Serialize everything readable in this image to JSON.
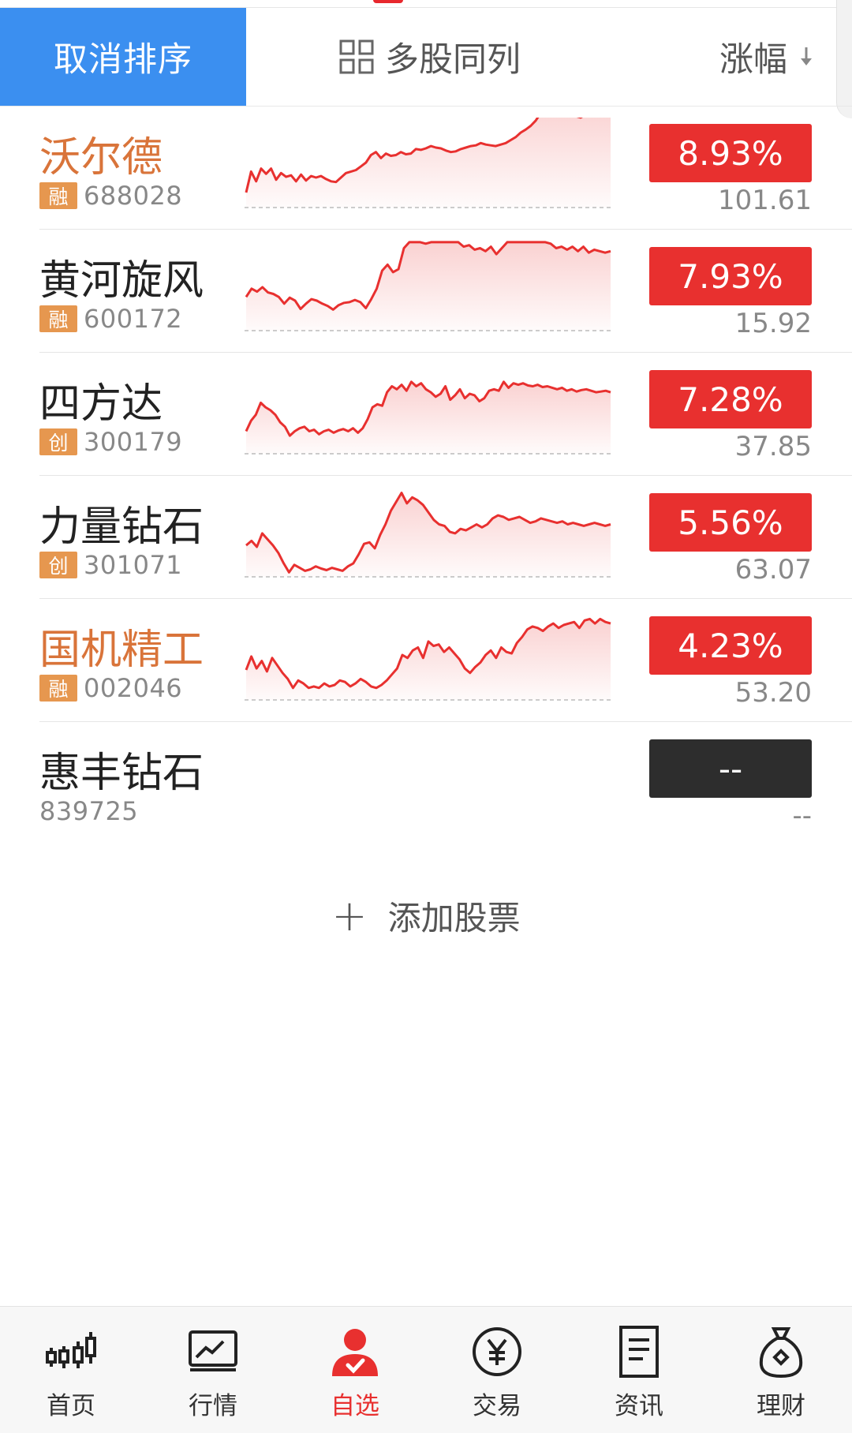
{
  "header": {
    "cancel_sort_label": "取消排序",
    "multi_column_label": "多股同列",
    "sort_label": "涨幅"
  },
  "stocks": [
    {
      "name": "沃尔德",
      "name_color": "orange",
      "badge": "融",
      "code": "688028",
      "change": "8.93%",
      "price": "101.61",
      "trend": [
        20,
        48,
        35,
        52,
        45,
        52,
        37,
        46,
        41,
        43,
        35,
        44,
        36,
        42,
        40,
        42,
        38,
        35,
        34,
        40,
        46,
        48,
        50,
        55,
        60,
        70,
        74,
        66,
        72,
        69,
        70,
        74,
        71,
        72,
        78,
        77,
        79,
        82,
        80,
        79,
        76,
        74,
        75,
        78,
        80,
        82,
        83,
        86,
        84,
        83,
        82,
        84,
        86,
        90,
        94,
        100,
        104,
        109,
        116,
        126,
        140,
        130,
        126,
        124,
        126,
        128,
        122,
        120,
        124,
        126,
        124,
        127,
        124,
        122
      ]
    },
    {
      "name": "黄河旋风",
      "name_color": "normal",
      "badge": "融",
      "code": "600172",
      "change": "7.93%",
      "price": "15.92",
      "trend": [
        45,
        56,
        52,
        58,
        51,
        49,
        45,
        36,
        44,
        40,
        29,
        36,
        42,
        40,
        36,
        33,
        28,
        34,
        37,
        38,
        41,
        38,
        30,
        42,
        56,
        80,
        88,
        78,
        82,
        110,
        118,
        118,
        118,
        116,
        118,
        118,
        118,
        118,
        118,
        118,
        112,
        114,
        108,
        110,
        106,
        112,
        102,
        110,
        118,
        118,
        118,
        118,
        118,
        118,
        118,
        118,
        116,
        110,
        112,
        108,
        112,
        106,
        112,
        104,
        108,
        106,
        104,
        106
      ]
    },
    {
      "name": "四方达",
      "name_color": "normal",
      "badge": "创",
      "code": "300179",
      "change": "7.28%",
      "price": "37.85",
      "trend": [
        30,
        44,
        52,
        68,
        62,
        58,
        52,
        42,
        36,
        24,
        30,
        34,
        36,
        30,
        32,
        26,
        30,
        32,
        28,
        31,
        33,
        30,
        34,
        28,
        34,
        46,
        62,
        66,
        64,
        82,
        90,
        86,
        92,
        84,
        96,
        90,
        94,
        86,
        82,
        76,
        80,
        90,
        72,
        78,
        86,
        74,
        80,
        78,
        70,
        74,
        84,
        86,
        84,
        96,
        88,
        94,
        92,
        94,
        91,
        90,
        92,
        89,
        90,
        88,
        86,
        88,
        84,
        86,
        83,
        85,
        86,
        84,
        82,
        83,
        84,
        82
      ]
    },
    {
      "name": "力量钻石",
      "name_color": "normal",
      "badge": "创",
      "code": "301071",
      "change": "5.56%",
      "price": "63.07",
      "trend": [
        42,
        48,
        40,
        58,
        50,
        42,
        32,
        18,
        6,
        16,
        12,
        8,
        10,
        14,
        11,
        9,
        12,
        10,
        8,
        14,
        18,
        30,
        44,
        46,
        38,
        56,
        70,
        88,
        100,
        112,
        98,
        106,
        102,
        96,
        86,
        76,
        70,
        68,
        60,
        58,
        64,
        62,
        66,
        70,
        66,
        70,
        78,
        82,
        80,
        76,
        78,
        80,
        76,
        72,
        74,
        78,
        76,
        74,
        72,
        74,
        70,
        72,
        70,
        68,
        70,
        72,
        70,
        68,
        70
      ]
    },
    {
      "name": "国机精工",
      "name_color": "orange",
      "badge": "融",
      "code": "002046",
      "change": "4.23%",
      "price": "53.20",
      "trend": [
        40,
        58,
        42,
        52,
        38,
        56,
        46,
        36,
        28,
        16,
        26,
        22,
        16,
        18,
        16,
        22,
        18,
        20,
        26,
        24,
        18,
        22,
        28,
        24,
        18,
        16,
        20,
        26,
        34,
        42,
        60,
        56,
        66,
        70,
        56,
        78,
        72,
        74,
        64,
        70,
        62,
        54,
        42,
        36,
        44,
        50,
        60,
        66,
        56,
        70,
        64,
        62,
        76,
        84,
        94,
        98,
        96,
        92,
        98,
        102,
        96,
        100,
        102,
        104,
        96,
        106,
        108,
        102,
        108,
        104,
        102
      ]
    },
    {
      "name": "惠丰钻石",
      "name_color": "normal",
      "badge": "",
      "code": "839725",
      "change": "--",
      "price": "--",
      "trend": []
    }
  ],
  "add_stock_label": "添加股票",
  "tabs": [
    {
      "key": "home",
      "label": "首页",
      "icon": "candlestick-icon"
    },
    {
      "key": "market",
      "label": "行情",
      "icon": "chart-line-icon"
    },
    {
      "key": "watchlist",
      "label": "自选",
      "icon": "user-check-icon",
      "active": true
    },
    {
      "key": "trade",
      "label": "交易",
      "icon": "yuan-icon"
    },
    {
      "key": "news",
      "label": "资讯",
      "icon": "document-icon"
    },
    {
      "key": "wealth",
      "label": "理财",
      "icon": "money-bag-icon"
    }
  ],
  "colors": {
    "up": "#e8302f",
    "accent": "#3b8ff0",
    "badge": "#e6974f",
    "orange_name": "#d9743a"
  }
}
